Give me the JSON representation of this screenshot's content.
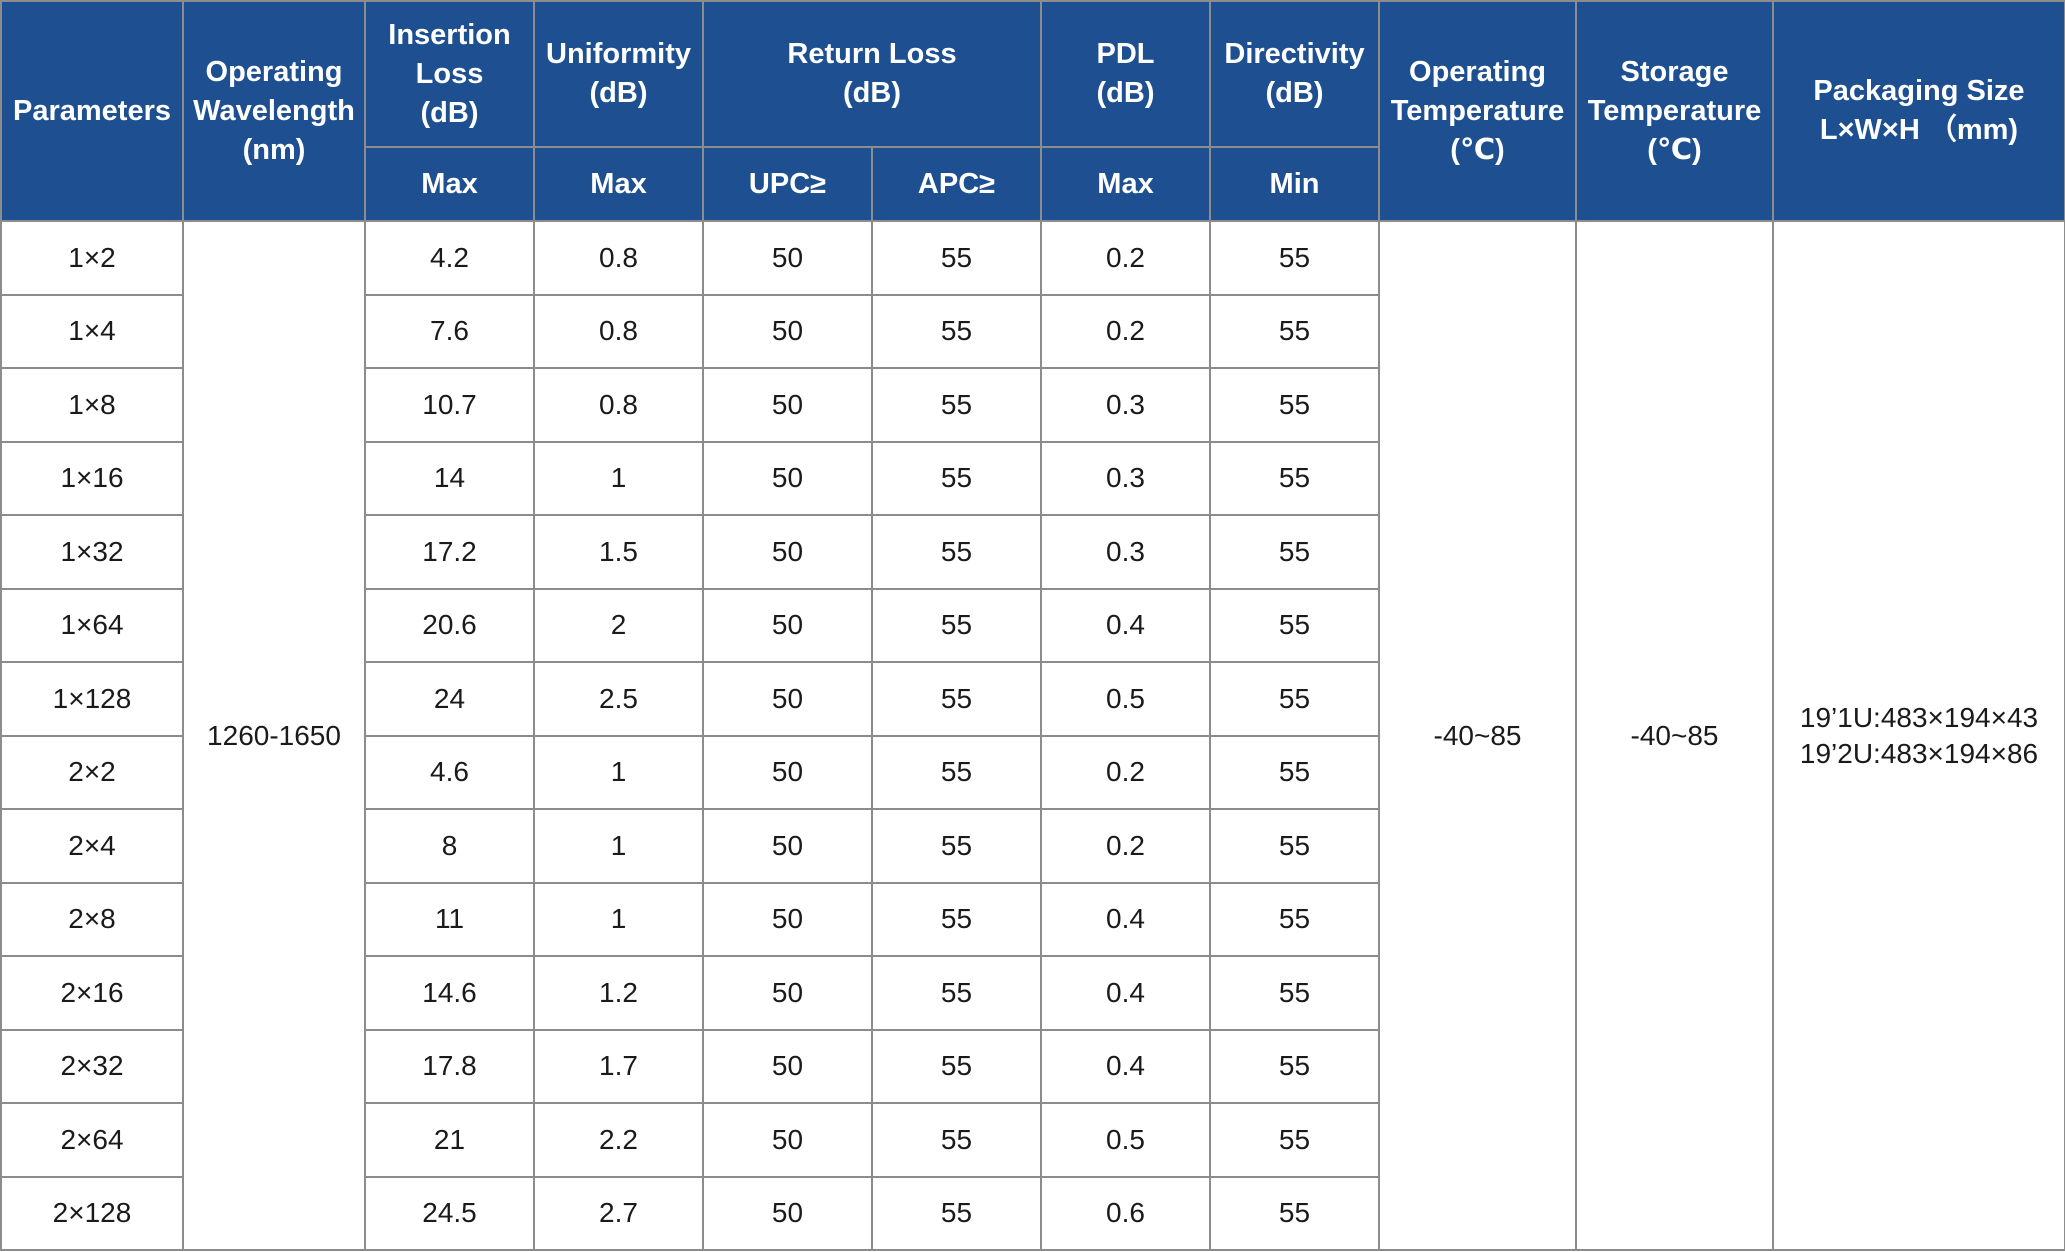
{
  "header": {
    "parameters": "Parameters",
    "wavelength": [
      "Operating",
      "Wavelength",
      "(nm)"
    ],
    "insertion_loss": [
      "Insertion",
      "Loss",
      "(dB)"
    ],
    "uniformity": [
      "Uniformity",
      "(dB)"
    ],
    "return_loss": [
      "Return Loss",
      "(dB)"
    ],
    "pdl": [
      "PDL",
      "(dB)"
    ],
    "directivity": [
      "Directivity",
      "(dB)"
    ],
    "op_temp": [
      "Operating",
      "Temperature",
      "(℃)"
    ],
    "storage_temp": [
      "Storage",
      "Temperature",
      "(℃)"
    ],
    "packaging": [
      "Packaging Size",
      "L×W×H （mm)"
    ],
    "sub": {
      "insertion_loss": "Max",
      "uniformity": "Max",
      "upc": "UPC≥",
      "apc": "APC≥",
      "pdl": "Max",
      "directivity": "Min"
    }
  },
  "shared": {
    "wavelength": "1260-1650",
    "op_temp": "-40~85",
    "storage_temp": "-40~85",
    "packaging": [
      "19’1U:483×194×43",
      "19’2U:483×194×86"
    ]
  },
  "rows": [
    {
      "param": "1×2",
      "il": "4.2",
      "uni": "0.8",
      "upc": "50",
      "apc": "55",
      "pdl": "0.2",
      "dir": "55"
    },
    {
      "param": "1×4",
      "il": "7.6",
      "uni": "0.8",
      "upc": "50",
      "apc": "55",
      "pdl": "0.2",
      "dir": "55"
    },
    {
      "param": "1×8",
      "il": "10.7",
      "uni": "0.8",
      "upc": "50",
      "apc": "55",
      "pdl": "0.3",
      "dir": "55"
    },
    {
      "param": "1×16",
      "il": "14",
      "uni": "1",
      "upc": "50",
      "apc": "55",
      "pdl": "0.3",
      "dir": "55"
    },
    {
      "param": "1×32",
      "il": "17.2",
      "uni": "1.5",
      "upc": "50",
      "apc": "55",
      "pdl": "0.3",
      "dir": "55"
    },
    {
      "param": "1×64",
      "il": "20.6",
      "uni": "2",
      "upc": "50",
      "apc": "55",
      "pdl": "0.4",
      "dir": "55"
    },
    {
      "param": "1×128",
      "il": "24",
      "uni": "2.5",
      "upc": "50",
      "apc": "55",
      "pdl": "0.5",
      "dir": "55"
    },
    {
      "param": "2×2",
      "il": "4.6",
      "uni": "1",
      "upc": "50",
      "apc": "55",
      "pdl": "0.2",
      "dir": "55"
    },
    {
      "param": "2×4",
      "il": "8",
      "uni": "1",
      "upc": "50",
      "apc": "55",
      "pdl": "0.2",
      "dir": "55"
    },
    {
      "param": "2×8",
      "il": "11",
      "uni": "1",
      "upc": "50",
      "apc": "55",
      "pdl": "0.4",
      "dir": "55"
    },
    {
      "param": "2×16",
      "il": "14.6",
      "uni": "1.2",
      "upc": "50",
      "apc": "55",
      "pdl": "0.4",
      "dir": "55"
    },
    {
      "param": "2×32",
      "il": "17.8",
      "uni": "1.7",
      "upc": "50",
      "apc": "55",
      "pdl": "0.4",
      "dir": "55"
    },
    {
      "param": "2×64",
      "il": "21",
      "uni": "2.2",
      "upc": "50",
      "apc": "55",
      "pdl": "0.5",
      "dir": "55"
    },
    {
      "param": "2×128",
      "il": "24.5",
      "uni": "2.7",
      "upc": "50",
      "apc": "55",
      "pdl": "0.6",
      "dir": "55"
    }
  ],
  "colors": {
    "header_bg": "#1d4f91",
    "header_text": "#ffffff",
    "border": "#8c8c8c",
    "body_text": "#1a1a1a"
  }
}
